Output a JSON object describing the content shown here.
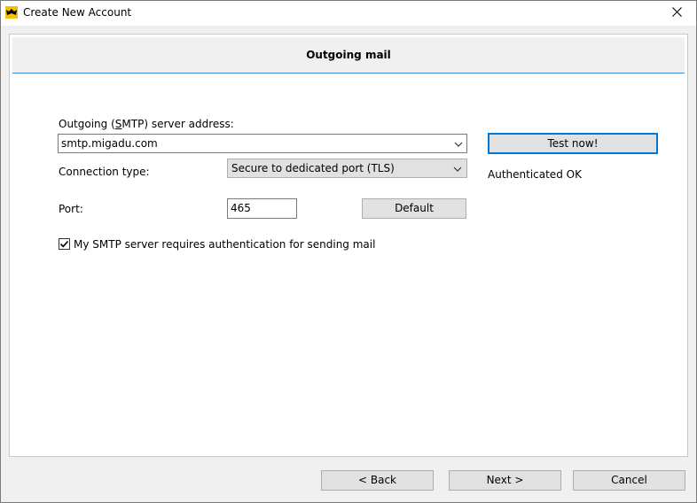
{
  "window": {
    "title": "Create New Account",
    "icons": {
      "app": "bat-icon",
      "close": "close-icon"
    }
  },
  "header": {
    "title": "Outgoing mail"
  },
  "smtp": {
    "label_pre": "Outgoing (",
    "label_underlined": "S",
    "label_post": "MTP) server address:",
    "server_value": "smtp.migadu.com",
    "test_button": "Test now!",
    "status": "Authenticated OK"
  },
  "connection": {
    "label": "Connection type:",
    "selected": "Secure to dedicated port (TLS)"
  },
  "port": {
    "label": "Port:",
    "value": "465",
    "default_button": "Default"
  },
  "auth": {
    "checked": true,
    "label": "My SMTP server requires authentication for sending mail"
  },
  "footer": {
    "back": "<  Back",
    "next": "Next  >",
    "cancel": "Cancel"
  },
  "colors": {
    "accent": "#0078d7",
    "header_rule": "#3c8fd6",
    "button_face": "#e1e1e1"
  }
}
